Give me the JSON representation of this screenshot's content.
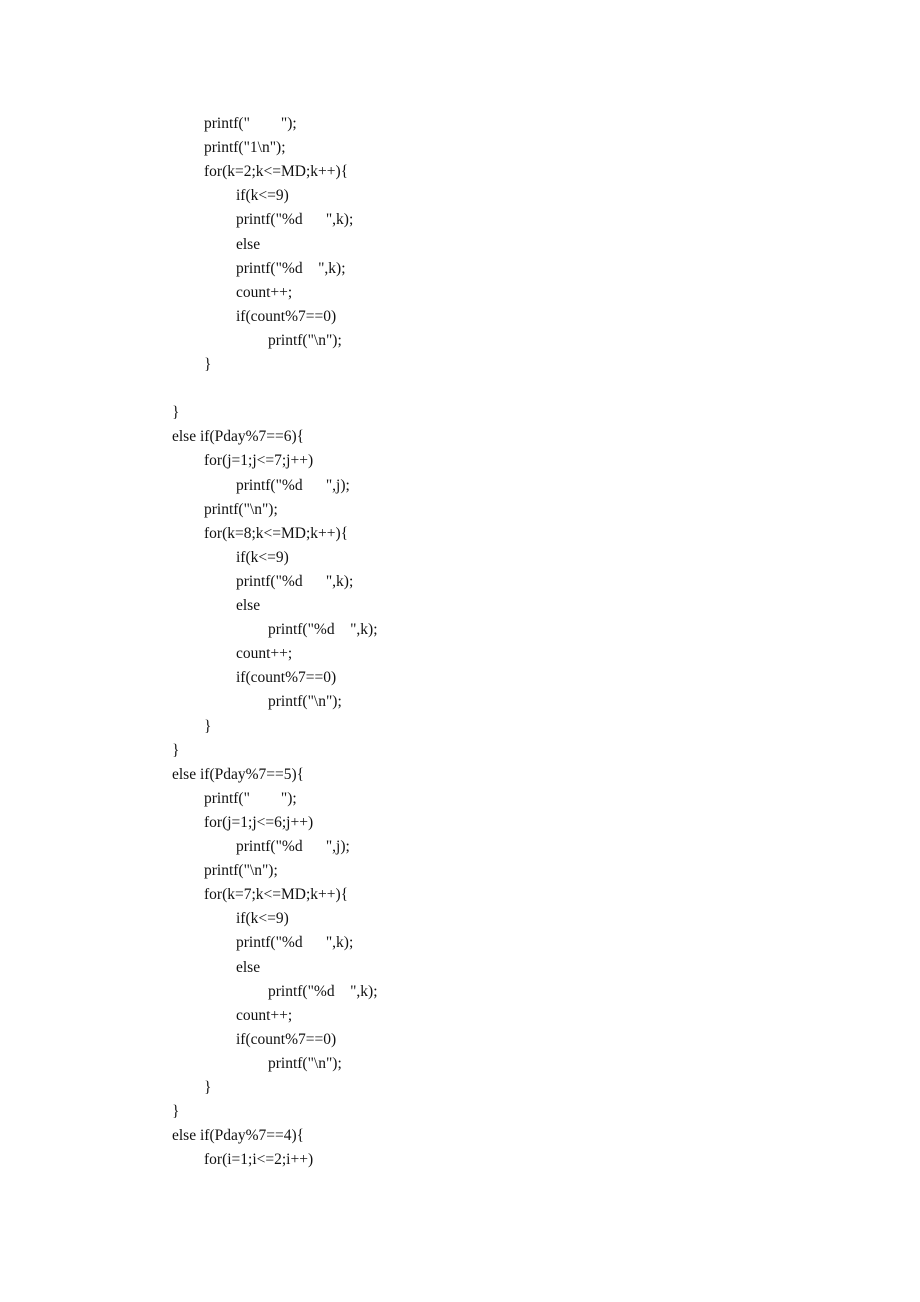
{
  "document": {
    "code_lines": [
      {
        "indent": 1,
        "text": "printf(\"        \");"
      },
      {
        "indent": 1,
        "text": "printf(\"1\\n\");"
      },
      {
        "indent": 1,
        "text": "for(k=2;k<=MD;k++){"
      },
      {
        "indent": 2,
        "text": "if(k<=9)"
      },
      {
        "indent": 2,
        "text": "printf(\"%d      \",k);"
      },
      {
        "indent": 2,
        "text": "else"
      },
      {
        "indent": 2,
        "text": "printf(\"%d    \",k);"
      },
      {
        "indent": 2,
        "text": "count++;"
      },
      {
        "indent": 2,
        "text": "if(count%7==0)"
      },
      {
        "indent": 3,
        "text": "printf(\"\\n\");"
      },
      {
        "indent": 1,
        "text": "}"
      },
      {
        "indent": 0,
        "text": ""
      },
      {
        "indent": 0,
        "text": "}"
      },
      {
        "indent": 0,
        "text": "else if(Pday%7==6){"
      },
      {
        "indent": 1,
        "text": "for(j=1;j<=7;j++)"
      },
      {
        "indent": 2,
        "text": "printf(\"%d      \",j);"
      },
      {
        "indent": 1,
        "text": "printf(\"\\n\");"
      },
      {
        "indent": 1,
        "text": "for(k=8;k<=MD;k++){"
      },
      {
        "indent": 2,
        "text": "if(k<=9)"
      },
      {
        "indent": 2,
        "text": "printf(\"%d      \",k);"
      },
      {
        "indent": 2,
        "text": "else"
      },
      {
        "indent": 3,
        "text": "printf(\"%d    \",k);"
      },
      {
        "indent": 2,
        "text": "count++;"
      },
      {
        "indent": 2,
        "text": "if(count%7==0)"
      },
      {
        "indent": 3,
        "text": "printf(\"\\n\");"
      },
      {
        "indent": 1,
        "text": "}"
      },
      {
        "indent": 0,
        "text": "}"
      },
      {
        "indent": 0,
        "text": "else if(Pday%7==5){"
      },
      {
        "indent": 1,
        "text": "printf(\"        \");"
      },
      {
        "indent": 1,
        "text": "for(j=1;j<=6;j++)"
      },
      {
        "indent": 2,
        "text": "printf(\"%d      \",j);"
      },
      {
        "indent": 1,
        "text": "printf(\"\\n\");"
      },
      {
        "indent": 1,
        "text": "for(k=7;k<=MD;k++){"
      },
      {
        "indent": 2,
        "text": "if(k<=9)"
      },
      {
        "indent": 2,
        "text": "printf(\"%d      \",k);"
      },
      {
        "indent": 2,
        "text": "else"
      },
      {
        "indent": 3,
        "text": "printf(\"%d    \",k);"
      },
      {
        "indent": 2,
        "text": "count++;"
      },
      {
        "indent": 2,
        "text": "if(count%7==0)"
      },
      {
        "indent": 3,
        "text": "printf(\"\\n\");"
      },
      {
        "indent": 1,
        "text": "}"
      },
      {
        "indent": 0,
        "text": "}"
      },
      {
        "indent": 0,
        "text": "else if(Pday%7==4){"
      },
      {
        "indent": 1,
        "text": "for(i=1;i<=2;i++)"
      }
    ]
  }
}
